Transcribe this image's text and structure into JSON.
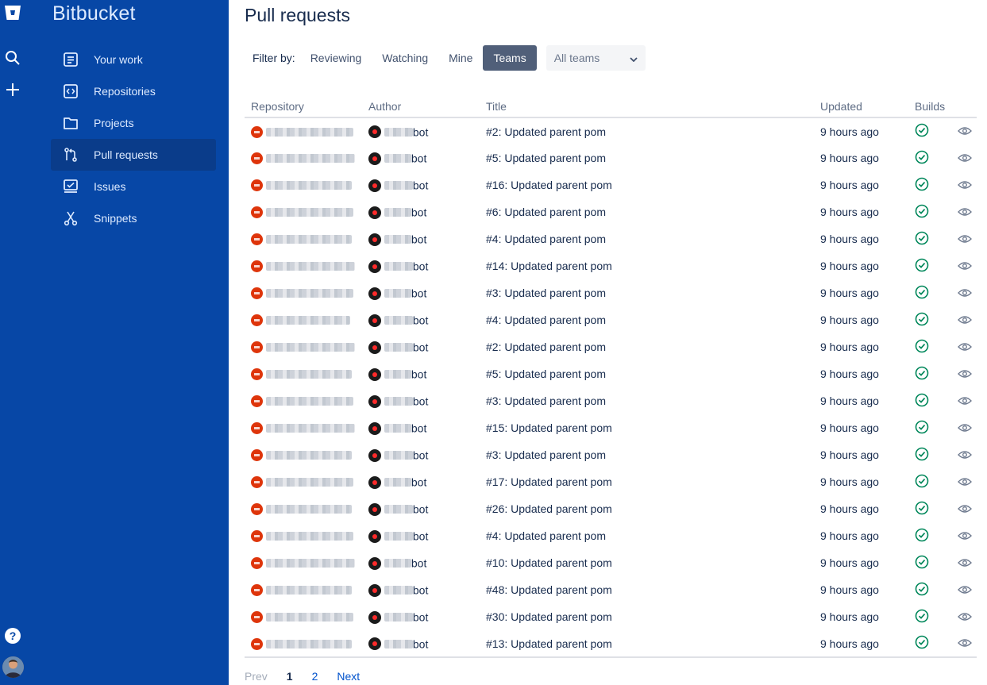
{
  "app": {
    "name": "Bitbucket"
  },
  "colors": {
    "sidebar": "#0747a6",
    "selected_filter": "#505f79",
    "repo_avatar": "#de350b",
    "build_success": "#00875a",
    "link": "#0052cc"
  },
  "rail": {
    "help_label": "?"
  },
  "sidebar": {
    "items": [
      {
        "label": "Your work",
        "icon": "your-work-icon"
      },
      {
        "label": "Repositories",
        "icon": "code-icon"
      },
      {
        "label": "Projects",
        "icon": "folder-icon"
      },
      {
        "label": "Pull requests",
        "icon": "pull-request-icon",
        "active": true
      },
      {
        "label": "Issues",
        "icon": "issues-icon"
      },
      {
        "label": "Snippets",
        "icon": "snippet-icon"
      }
    ]
  },
  "page": {
    "title": "Pull requests"
  },
  "filter": {
    "label": "Filter by:",
    "buttons": [
      "Reviewing",
      "Watching",
      "Mine",
      "Teams"
    ],
    "selected": "Teams",
    "select_value": "All teams"
  },
  "table": {
    "headers": {
      "repository": "Repository",
      "author": "Author",
      "title": "Title",
      "updated": "Updated",
      "builds": "Builds"
    },
    "rows": [
      {
        "author_suffix": "bot",
        "title": "#2: Updated parent pom",
        "updated": "9 hours ago",
        "build": "success"
      },
      {
        "author_suffix": "bot",
        "title": "#5: Updated parent pom",
        "updated": "9 hours ago",
        "build": "success"
      },
      {
        "author_suffix": "bot",
        "title": "#16: Updated parent pom",
        "updated": "9 hours ago",
        "build": "success"
      },
      {
        "author_suffix": "bot",
        "title": "#6: Updated parent pom",
        "updated": "9 hours ago",
        "build": "success"
      },
      {
        "author_suffix": "bot",
        "title": "#4: Updated parent pom",
        "updated": "9 hours ago",
        "build": "success"
      },
      {
        "author_suffix": "bot",
        "title": "#14: Updated parent pom",
        "updated": "9 hours ago",
        "build": "success"
      },
      {
        "author_suffix": "bot",
        "title": "#3: Updated parent pom",
        "updated": "9 hours ago",
        "build": "success"
      },
      {
        "author_suffix": "bot",
        "title": "#4: Updated parent pom",
        "updated": "9 hours ago",
        "build": "success"
      },
      {
        "author_suffix": "bot",
        "title": "#2: Updated parent pom",
        "updated": "9 hours ago",
        "build": "success"
      },
      {
        "author_suffix": "bot",
        "title": "#5: Updated parent pom",
        "updated": "9 hours ago",
        "build": "success"
      },
      {
        "author_suffix": "bot",
        "title": "#3: Updated parent pom",
        "updated": "9 hours ago",
        "build": "success"
      },
      {
        "author_suffix": "bot",
        "title": "#15: Updated parent pom",
        "updated": "9 hours ago",
        "build": "success"
      },
      {
        "author_suffix": "bot",
        "title": "#3: Updated parent pom",
        "updated": "9 hours ago",
        "build": "success"
      },
      {
        "author_suffix": "bot",
        "title": "#17: Updated parent pom",
        "updated": "9 hours ago",
        "build": "success"
      },
      {
        "author_suffix": "bot",
        "title": "#26: Updated parent pom",
        "updated": "9 hours ago",
        "build": "success"
      },
      {
        "author_suffix": "bot",
        "title": "#4: Updated parent pom",
        "updated": "9 hours ago",
        "build": "success"
      },
      {
        "author_suffix": "bot",
        "title": "#10: Updated parent pom",
        "updated": "9 hours ago",
        "build": "success"
      },
      {
        "author_suffix": "bot",
        "title": "#48: Updated parent pom",
        "updated": "9 hours ago",
        "build": "success"
      },
      {
        "author_suffix": "bot",
        "title": "#30: Updated parent pom",
        "updated": "9 hours ago",
        "build": "success"
      },
      {
        "author_suffix": "bot",
        "title": "#13: Updated parent pom",
        "updated": "9 hours ago",
        "build": "success"
      }
    ]
  },
  "pagination": {
    "prev": "Prev",
    "pages": [
      "1",
      "2"
    ],
    "current": "1",
    "next": "Next"
  }
}
